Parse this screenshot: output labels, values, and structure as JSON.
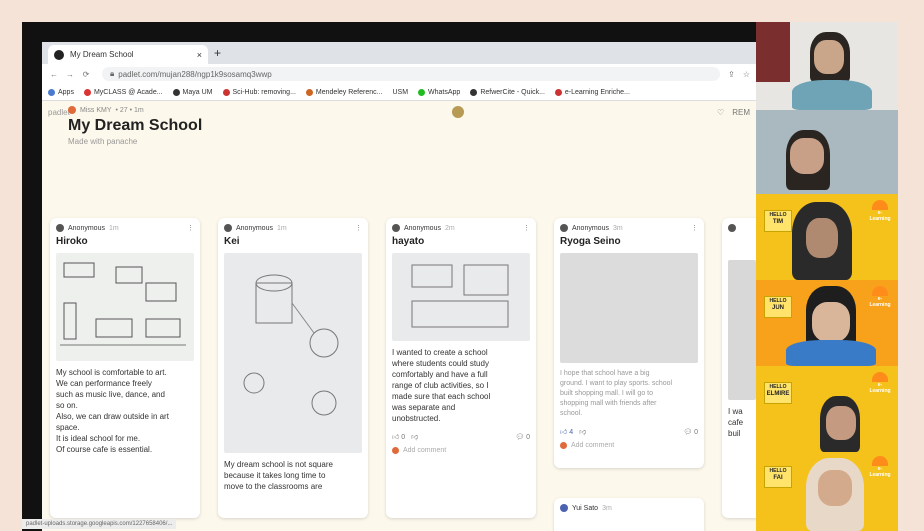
{
  "browser": {
    "tab_title": "My Dream School",
    "url": "padlet.com/mujan288/ngp1k9sosamq3wwp",
    "bookmarks": [
      "Apps",
      "MyCLASS @ Acade...",
      "Maya UM",
      "Sci-Hub: removing...",
      "Mendeley Referenc...",
      "USM",
      "WhatsApp",
      "RefwerCite - Quick...",
      "e-Learning Enriche..."
    ],
    "status_url": "padlet-uploads.storage.googleapis.com/1227658406/..."
  },
  "padlet": {
    "brand": "padlet",
    "author": "Miss KMY",
    "author_meta": "• 27 • 1m",
    "title": "My Dream School",
    "subtitle": "Made with panache",
    "top_right": "REM"
  },
  "posts": [
    {
      "author": "Anonymous",
      "time": "1m",
      "name": "Hiroko",
      "text": [
        "My school is comfortable to art.",
        "We can performance freely",
        "such as music live, dance, and",
        "so on.",
        "Also, we can draw outside in art",
        "space.",
        "It is ideal school for me.",
        "Of course cafe is essential."
      ]
    },
    {
      "author": "Anonymous",
      "time": "1m",
      "name": "Kei",
      "text": [
        "My dream school is not square",
        "because it takes long time to",
        "move to the classrooms are"
      ]
    },
    {
      "author": "Anonymous",
      "time": "2m",
      "name": "hayato",
      "text": [
        "I wanted to create a school",
        "where students could study",
        "comfortably and have a full",
        "range of club activities, so I",
        "made sure that each school",
        "was separate and",
        "unobstructed."
      ],
      "likes": "0",
      "comments": "0",
      "add_comment": "Add comment"
    },
    {
      "author": "Anonymous",
      "time": "3m",
      "name": "Ryoga Seino",
      "text": [
        "I hope that school have a big",
        "ground. I want to play sports. school",
        "built shopping mall. I will go to",
        "shopping mall with friends after",
        "school."
      ],
      "likes": "4",
      "comments": "0",
      "add_comment": "Add comment"
    }
  ],
  "next_post": {
    "author": "Yui Sato",
    "time": "3m"
  },
  "partial_col": {
    "lines": [
      "I wa",
      "cafe",
      "buil"
    ]
  },
  "participants": [
    {
      "name": "",
      "badge": false
    },
    {
      "name": "",
      "badge": false
    },
    {
      "name": "TIM",
      "badge": true
    },
    {
      "name": "JUN",
      "badge": true
    },
    {
      "name": "ELMIRE",
      "badge": true
    },
    {
      "name": "FAI",
      "badge": true
    }
  ],
  "badge_word": "HELLO",
  "badge_sub": "MY NAME IS",
  "logo_text": "e-Learning"
}
